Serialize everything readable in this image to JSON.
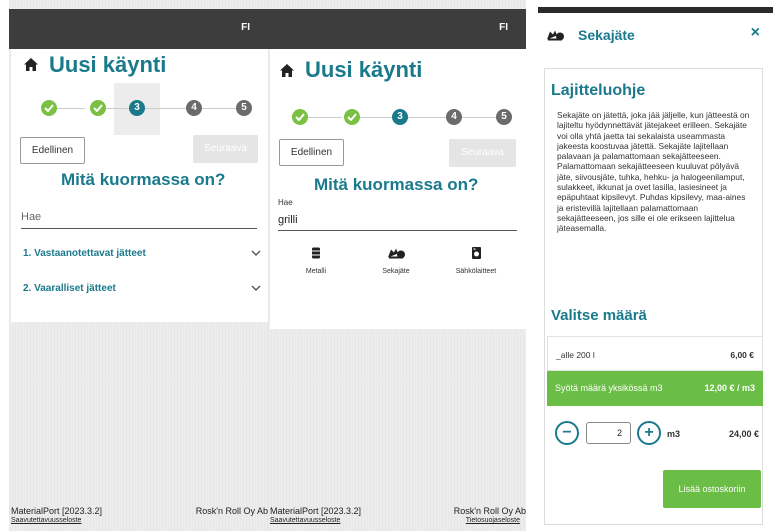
{
  "lang": "FI",
  "page_title": "Uusi käynti",
  "steps": [
    "1",
    "2",
    "3",
    "4",
    "5"
  ],
  "nav": {
    "prev_label": "Edellinen",
    "next_label": "Seuraava"
  },
  "question": "Mitä kuormassa on?",
  "search": {
    "placeholder": "Hae",
    "label": "Hae",
    "value": "grilli"
  },
  "accordion": [
    {
      "label": "1. Vastaanotettavat jätteet"
    },
    {
      "label": "2. Vaaralliset jätteet"
    }
  ],
  "categories": [
    {
      "label": "Metalli",
      "icon": "barrel-icon"
    },
    {
      "label": "Sekajäte",
      "icon": "mixed-waste-icon"
    },
    {
      "label": "Sähkölaitteet",
      "icon": "appliance-icon"
    }
  ],
  "footer": {
    "version": "MaterialPort [2023.3.2]",
    "accessibility_link": "Saavutettavuusseloste",
    "company": "Rosk'n Roll Oy Ab",
    "privacy_link": "Tietosuojaseloste"
  },
  "modal": {
    "title": "Sekajäte",
    "close_label": "×",
    "instructions_title": "Lajitteluohje",
    "instructions_text": "Sekajäte on jätettä, joka jää jäljelle, kun jätteestä on lajiteltu hyödynnettävät jätejakeet erilleen. Sekajäte voi olla yhtä jaetta tai sekalaista useammasta jakeesta koostuvaa jätettä. Sekajäte lajitellaan palavaan ja palamattomaan sekajätteeseen. Palamattomaan sekajätteeseen kuuluvat pölyävä jäte, siivousjäte, tuhka, hehku- ja halogeenilamput, sulakkeet, ikkunat ja ovet lasilla, lasiesineet ja epäpuhtaat kipsilevyt. Puhdas kipsilevy, maa-aines ja eristevillä lajitellaan palamattomaan sekajätteeseen, jos sille ei ole erikseen lajittelua jäteasemalla.",
    "amount_title": "Valitse määrä",
    "options": [
      {
        "label": "_alle 200 l",
        "price": "6,00 €"
      },
      {
        "label": "Syötä määrä yksikössä m3",
        "price": "12,00 € / m3"
      }
    ],
    "quantity": "2",
    "unit": "m3",
    "total": "24,00 €",
    "add_label": "Lisää ostoskoriin"
  },
  "colors": {
    "teal": "#1a7a8c",
    "green": "#7ac143",
    "button_green": "#6abd45",
    "topbar": "#3d3d3d"
  }
}
